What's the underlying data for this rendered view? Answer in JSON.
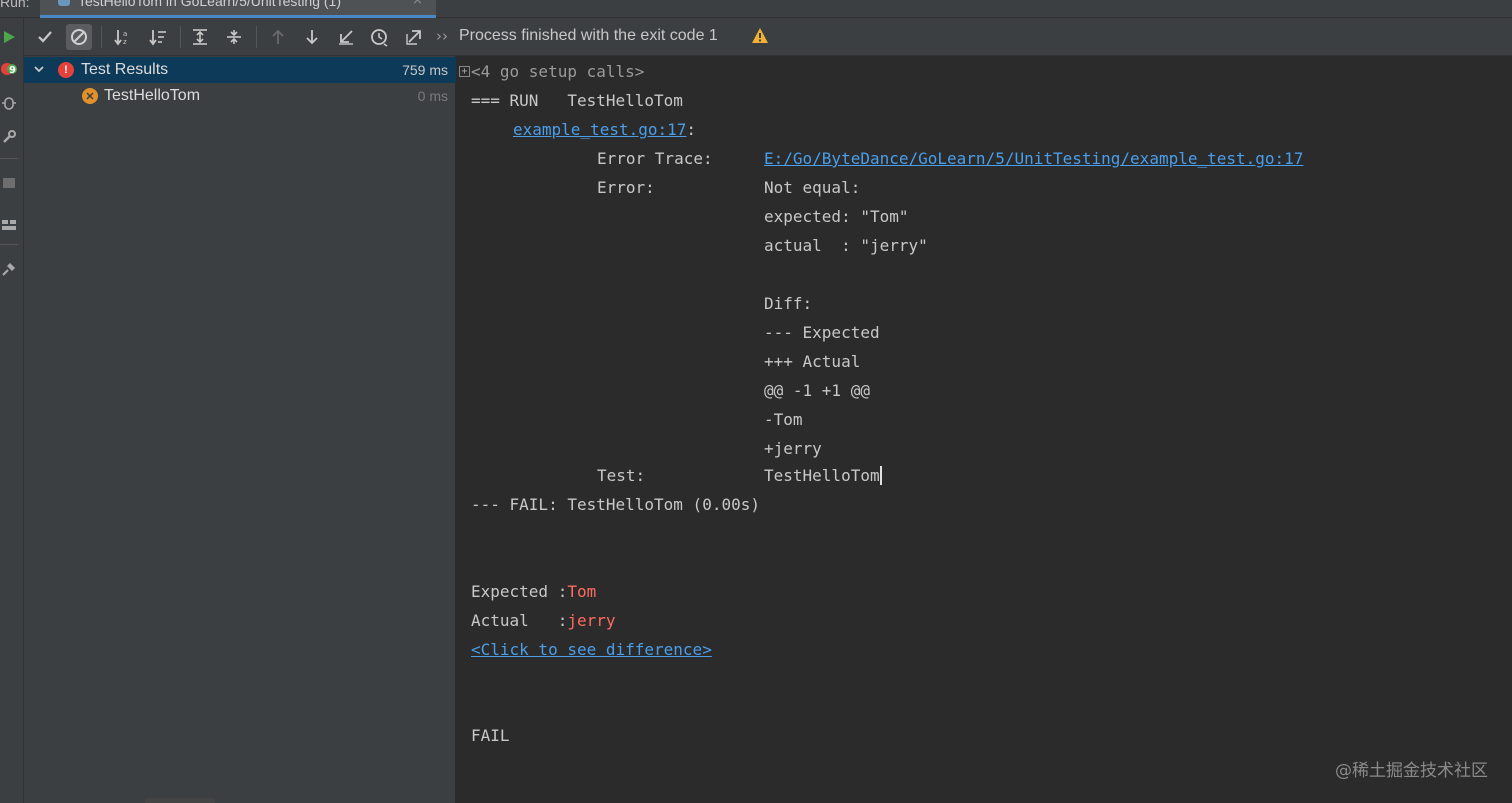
{
  "run_tab": {
    "label": "Run:",
    "title": "TestHelloTom in GoLearn/5/UnitTesting (1)",
    "close": "×"
  },
  "left_strip": {
    "run_icon": "play-icon",
    "rerun_failed_icon": "rerun-failed-icon",
    "debug_icon": "debug-icon",
    "settings_icon": "wrench-icon",
    "stop_icon": "stop-icon",
    "layout_icon": "layout-icon",
    "pin_icon": "pin-icon"
  },
  "toolbar": {
    "buttons": [
      {
        "icon": "show-passed-icon"
      },
      {
        "icon": "show-ignored-icon",
        "active": true
      },
      {
        "icon": "sort-alphabetically-icon"
      },
      {
        "icon": "sort-by-duration-icon"
      },
      {
        "icon": "expand-all-icon"
      },
      {
        "icon": "collapse-all-icon"
      },
      {
        "icon": "previous-failed-icon"
      },
      {
        "icon": "next-failed-icon"
      },
      {
        "icon": "import-tests-icon"
      },
      {
        "icon": "test-history-icon"
      },
      {
        "icon": "export-tests-icon"
      }
    ],
    "more": "››",
    "status": "Process finished with the exit code 1"
  },
  "tree": {
    "root": {
      "label": "Test Results",
      "time": "759 ms",
      "status": "error"
    },
    "children": [
      {
        "label": "TestHelloTom",
        "time": "0 ms",
        "status": "failed"
      }
    ]
  },
  "console": {
    "setup_calls": "<4 go setup calls>",
    "run_line": "=== RUN   TestHelloTom",
    "source_link": "example_test.go:17",
    "source_suffix": ":",
    "error_trace_label": "Error Trace:",
    "error_trace_link": "E:/Go/ByteDance/GoLearn/5/UnitTesting/example_test.go:17",
    "error_label": "Error:",
    "error_lines": [
      "Not equal:",
      "expected: \"Tom\"",
      "actual  : \"jerry\"",
      "",
      "Diff:",
      "--- Expected",
      "+++ Actual",
      "@@ -1 +1 @@",
      "-Tom",
      "+jerry"
    ],
    "test_label": "Test:",
    "test_value": "TestHelloTom",
    "fail_line": "--- FAIL: TestHelloTom (0.00s)",
    "expected_label": "Expected :",
    "expected_value": "Tom",
    "actual_label": "Actual   :",
    "actual_value": "jerry",
    "diff_link": "<Click to see difference>",
    "final": "FAIL"
  },
  "watermark": "@稀土掘金技术社区",
  "colors": {
    "accent": "#4a88c7",
    "link": "#4a9eea",
    "error": "#e5403a",
    "failed": "#e0912b",
    "warning": "#f2b134",
    "selection": "#0d3a58"
  }
}
